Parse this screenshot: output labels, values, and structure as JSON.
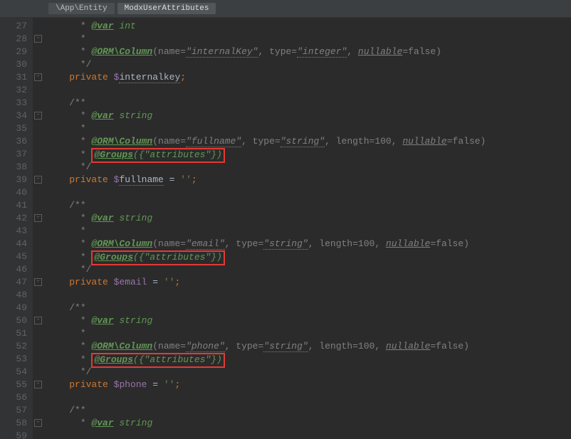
{
  "breadcrumb": {
    "path": "\\App\\Entity",
    "class": "ModxUserAttributes"
  },
  "gutter": {
    "start": 27,
    "end": 59
  },
  "folds": [
    1,
    4,
    7,
    12,
    15,
    20,
    23,
    28,
    31
  ],
  "code": {
    "l27": {
      "pre": "     ",
      "star": " * ",
      "tag": "@var",
      "after": " int"
    },
    "l28": {
      "pre": "     ",
      "star": " *"
    },
    "l29": {
      "pre": "     ",
      "star": " * ",
      "tag": "@ORM\\Column",
      "args1": "(name=",
      "s1": "\"internalKey\"",
      "args2": ", type=",
      "s2": "\"integer\"",
      "args3": ", ",
      "nullable": "nullable",
      "args4": "=false)"
    },
    "l30": {
      "pre": "     ",
      "star": " */"
    },
    "l31": {
      "kw": "private ",
      "dollar": "$",
      "name": "internalkey",
      "end": ";"
    },
    "l33": {
      "pre": "    ",
      "open": "/**"
    },
    "l34": {
      "pre": "     ",
      "star": " * ",
      "tag": "@var",
      "after": " string"
    },
    "l35": {
      "pre": "     ",
      "star": " *"
    },
    "l36": {
      "pre": "     ",
      "star": " * ",
      "tag": "@ORM\\Column",
      "args1": "(name=",
      "s1": "\"fullname\"",
      "args2": ", type=",
      "s2": "\"string\"",
      "args3": ", length=100, ",
      "nullable": "nullable",
      "args4": "=false)"
    },
    "l37": {
      "pre": "     ",
      "star": " * ",
      "box_tag": "@Groups",
      "box_args": "({\"attributes\"})"
    },
    "l38": {
      "pre": "     ",
      "star": " */"
    },
    "l39": {
      "kw": "private ",
      "dollar": "$",
      "name": "fullname",
      "eq": " = ",
      "val": "''",
      "end": ";"
    },
    "l41": {
      "pre": "    ",
      "open": "/**"
    },
    "l42": {
      "pre": "     ",
      "star": " * ",
      "tag": "@var",
      "after": " string"
    },
    "l43": {
      "pre": "     ",
      "star": " *"
    },
    "l44": {
      "pre": "     ",
      "star": " * ",
      "tag": "@ORM\\Column",
      "args1": "(name=",
      "s1": "\"email\"",
      "args2": ", type=",
      "s2": "\"string\"",
      "args3": ", length=100, ",
      "nullable": "nullable",
      "args4": "=false)"
    },
    "l45": {
      "pre": "     ",
      "star": " * ",
      "box_tag": "@Groups",
      "box_args": "({\"attributes\"})"
    },
    "l46": {
      "pre": "     ",
      "star": " */"
    },
    "l47": {
      "kw": "private ",
      "dollar": "$",
      "name": "email",
      "eq": " = ",
      "val": "''",
      "end": ";"
    },
    "l49": {
      "pre": "    ",
      "open": "/**"
    },
    "l50": {
      "pre": "     ",
      "star": " * ",
      "tag": "@var",
      "after": " string"
    },
    "l51": {
      "pre": "     ",
      "star": " *"
    },
    "l52": {
      "pre": "     ",
      "star": " * ",
      "tag": "@ORM\\Column",
      "args1": "(name=",
      "s1": "\"phone\"",
      "args2": ", type=",
      "s2": "\"string\"",
      "args3": ", length=100, ",
      "nullable": "nullable",
      "args4": "=false)"
    },
    "l53": {
      "pre": "     ",
      "star": " * ",
      "box_tag": "@Groups",
      "box_args": "({\"attributes\"})"
    },
    "l54": {
      "pre": "     ",
      "star": " */"
    },
    "l55": {
      "kw": "private ",
      "dollar": "$",
      "name": "phone",
      "eq": " = ",
      "val": "''",
      "end": ";"
    },
    "l57": {
      "pre": "    ",
      "open": "/**"
    },
    "l58": {
      "pre": "     ",
      "star": " * ",
      "tag": "@var",
      "after": " string"
    }
  }
}
